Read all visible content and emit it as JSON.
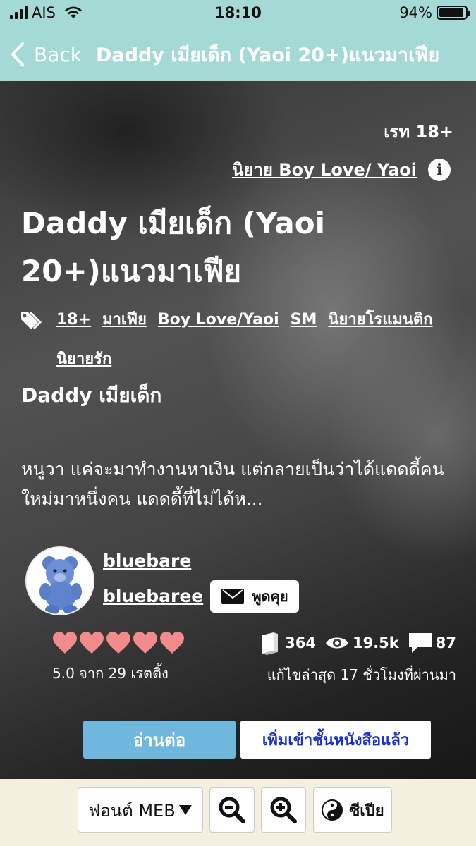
{
  "status_bar": {
    "carrier": "AIS",
    "time": "18:10",
    "battery": "94%",
    "battery_level": 0.94
  },
  "nav": {
    "back_label": "Back",
    "title": "Daddy เมียเด็ก (Yaoi 20+)แนวมาเฟีย"
  },
  "book": {
    "rating_label": "เรท 18+",
    "category": "นิยาย Boy Love/ Yaoi",
    "title": "Daddy เมียเด็ก (Yaoi 20+)แนวมาเฟีย",
    "tags": [
      "18+",
      "มาเฟีย",
      "Boy Love/Yaoi",
      "SM",
      "นิยายโรแมนติก",
      "นิยายรัก"
    ],
    "subtitle": "Daddy เมียเด็ก",
    "synopsis": "หนูวา แค่จะมาทำงานหาเงิน แต่กลายเป็นว่าได้แดดดี้คนใหม่มาหนึ่งคน แดดดี้ที่ไม่ได้ห..."
  },
  "author": {
    "pen_name": "bluebare",
    "username": "bluebaree",
    "chat_label": "พูดคุย"
  },
  "rating": {
    "hearts": 5,
    "label": "5.0 จาก 29 เรตติ้ง"
  },
  "stats": {
    "chapters": "364",
    "views": "19.5k",
    "comments": "87",
    "updated": "แก้ไขล่าสุด 17 ชั่วโมงที่ผ่านมา"
  },
  "actions": {
    "read_label": "อ่านต่อ",
    "shelf_label": "เพิ่มเข้าชั้นหนังสือแล้ว"
  },
  "toolbar": {
    "font_label": "ฟอนต์ MEB",
    "sepia_label": "ซีเปีย"
  },
  "colors": {
    "nav_bg": "#a4d9d6",
    "read_button": "#6fb7dd",
    "shelf_text": "#1a2fd0",
    "heart": "#f28b8b",
    "toolbar_bg": "#f4efdf"
  }
}
